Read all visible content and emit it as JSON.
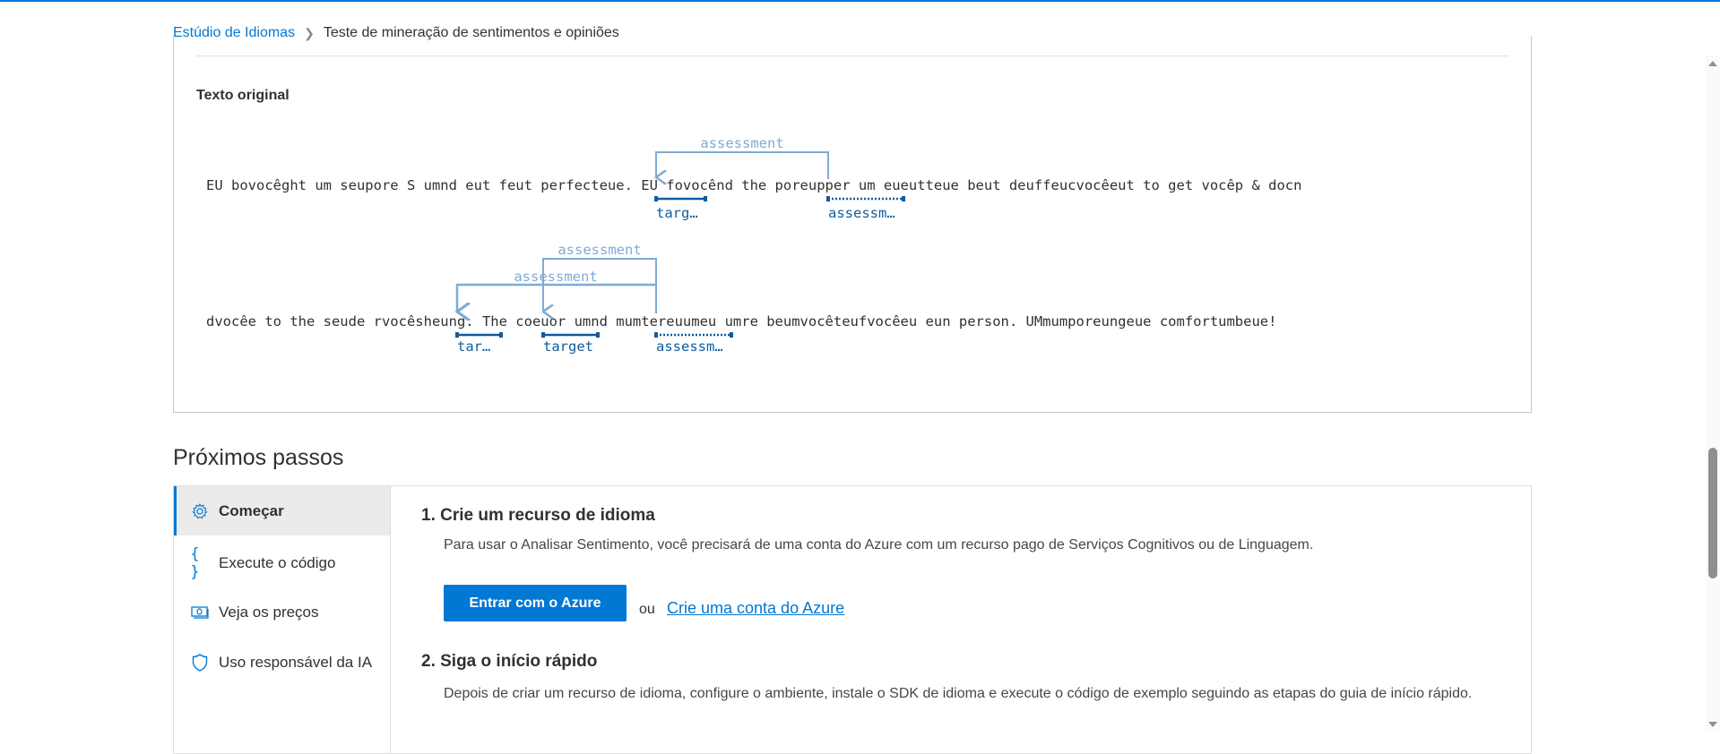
{
  "breadcrumb": {
    "root": "Estúdio de Idiomas",
    "current": "Teste de mineração de sentimentos e opiniões"
  },
  "original_text": {
    "title": "Texto original",
    "line1": "EU bovocêght um seupore S umnd eut feut perfecteue. EU fovocênd the poreupper um eueutteue beut deuffeucvocêeut to get vocêp & docn",
    "line2": "dvocêe to the seude rvocêsheung. The coeuor umnd mumtereuumeu umre beumvocêteufvocêeu eun person. UMmumporeungeue comfortumbeue!",
    "line1_annotations": {
      "arc_label": "assessment",
      "target_label": "targ…",
      "assessment_label": "assessm…"
    },
    "line2_annotations": {
      "arc1_label": "assessment",
      "arc2_label": "assessment",
      "target1_label": "tar…",
      "target2_label": "target",
      "assessment_label": "assessm…"
    },
    "colors": {
      "target": "#0f5c9e",
      "arc": "#7fabd3"
    }
  },
  "next_steps": {
    "title": "Próximos passos",
    "sidebar": [
      {
        "label": "Começar",
        "icon": "gear-icon",
        "active": true
      },
      {
        "label": "Execute o código",
        "icon": "braces-icon"
      },
      {
        "label": "Veja os preços",
        "icon": "money-icon"
      },
      {
        "label": "Uso responsável da IA",
        "icon": "shield-icon"
      }
    ],
    "step1": {
      "title": "1. Crie um recurso de idioma",
      "text": "Para usar o Analisar Sentimento, você precisará de uma conta do Azure com um recurso pago de Serviços Cognitivos ou de Linguagem.",
      "button": "Entrar com o Azure",
      "or": "ou",
      "link": "Crie uma conta do Azure"
    },
    "step2": {
      "title": "2. Siga o início rápido",
      "text": "Depois de criar um recurso de idioma, configure o ambiente, instale o SDK de idioma e execute o código de exemplo seguindo as etapas do guia de início rápido."
    }
  },
  "accent_color": "#0078d4"
}
